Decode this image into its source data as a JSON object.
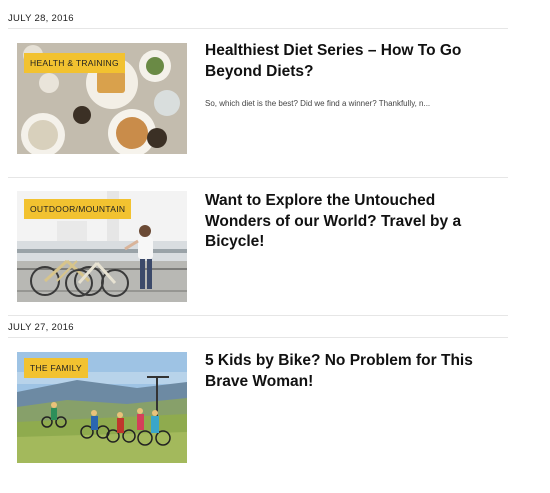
{
  "groups": [
    {
      "date": "JULY 28, 2016",
      "posts": [
        {
          "category": "HEALTH & TRAINING",
          "title": "Healthiest Diet Series – How To Go Beyond Diets?",
          "excerpt": "So, which diet is the best? Did we find a winner? Thankfully, n..."
        },
        {
          "category": "OUTDOOR/MOUNTAIN",
          "title": "Want to Explore the Untouched Wonders of our World? Travel by a Bicycle!",
          "excerpt": ""
        }
      ]
    },
    {
      "date": "JULY 27, 2016",
      "posts": [
        {
          "category": "THE FAMILY",
          "title": "5 Kids by Bike? No Problem for This Brave Woman!",
          "excerpt": ""
        }
      ]
    }
  ],
  "colors": {
    "tag_bg": "#f2c230",
    "divider": "#e6e6e6",
    "title": "#111111"
  }
}
